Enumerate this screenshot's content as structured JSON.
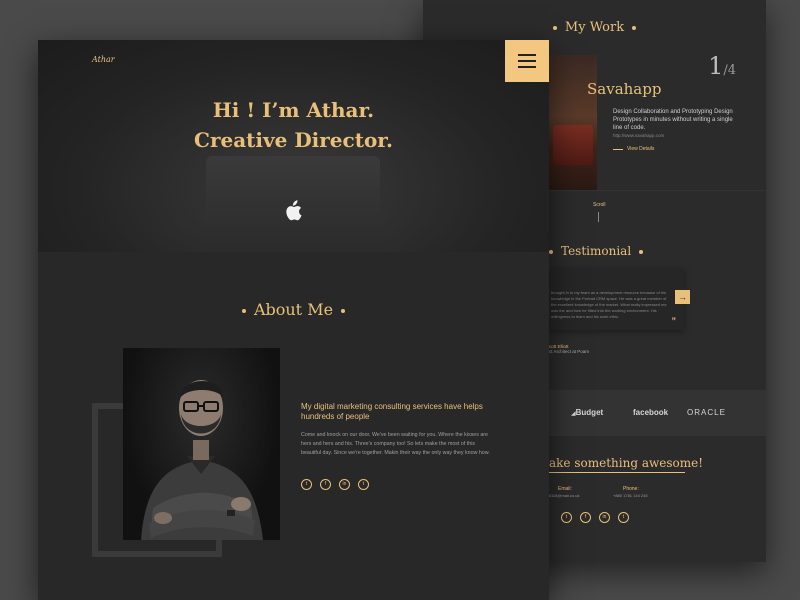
{
  "front": {
    "logo": "Athar",
    "hero_line1": "Hi ! I’m Athar.",
    "hero_line2": "Creative Director.",
    "about_title": "About Me",
    "about_heading": "My digital marketing consulting  services have helps hundreds of people",
    "about_body": "Come and knock on our door. We've been waiting for you. Where the kisses are hers and hers and his. Three's company too! So lets make the most of this beautiful day. Since we're together. Makin their way the only way they know how.",
    "social": [
      "twitter-icon",
      "facebook-icon",
      "linkedin-icon",
      "twitter-icon"
    ]
  },
  "back": {
    "work_title": "My Work",
    "counter_current": "1",
    "counter_total": "/4",
    "app_title": "Savahapp",
    "app_desc": "Design Collaboration and Prototyping Design Prototypes in minutes without writing a single line of code.",
    "app_link": "http://www.savahapp.com",
    "app_details": "View Details",
    "scroll": "Scroll",
    "testimonial_title": "Testimonial",
    "testimonial_text": "brought in to my team as a development resource because of his knowledge in the Portrait CRM space. He was a great member of the excellent knowledge of the market. What really impressed me was the and how he fitted into the working environment. His willingness to learn and his work ethic.",
    "testimonial_name": "cott Elliott",
    "testimonial_role": "ct Architect at Poam",
    "logos": [
      "Budget",
      "facebook",
      "ORACLE"
    ],
    "make_title": "ake something awesome!",
    "email_label": "Email:",
    "email_value": "ail118@mail.co.uk",
    "phone_label": "Phone:",
    "phone_value": "+880 1781 144 245",
    "social": [
      "twitter-icon",
      "facebook-icon",
      "linkedin-icon",
      "twitter-icon"
    ]
  },
  "colors": {
    "accent": "#e9c07a",
    "menu_button": "#f4c780",
    "background": "#4a4a4a",
    "page": "#282828"
  }
}
